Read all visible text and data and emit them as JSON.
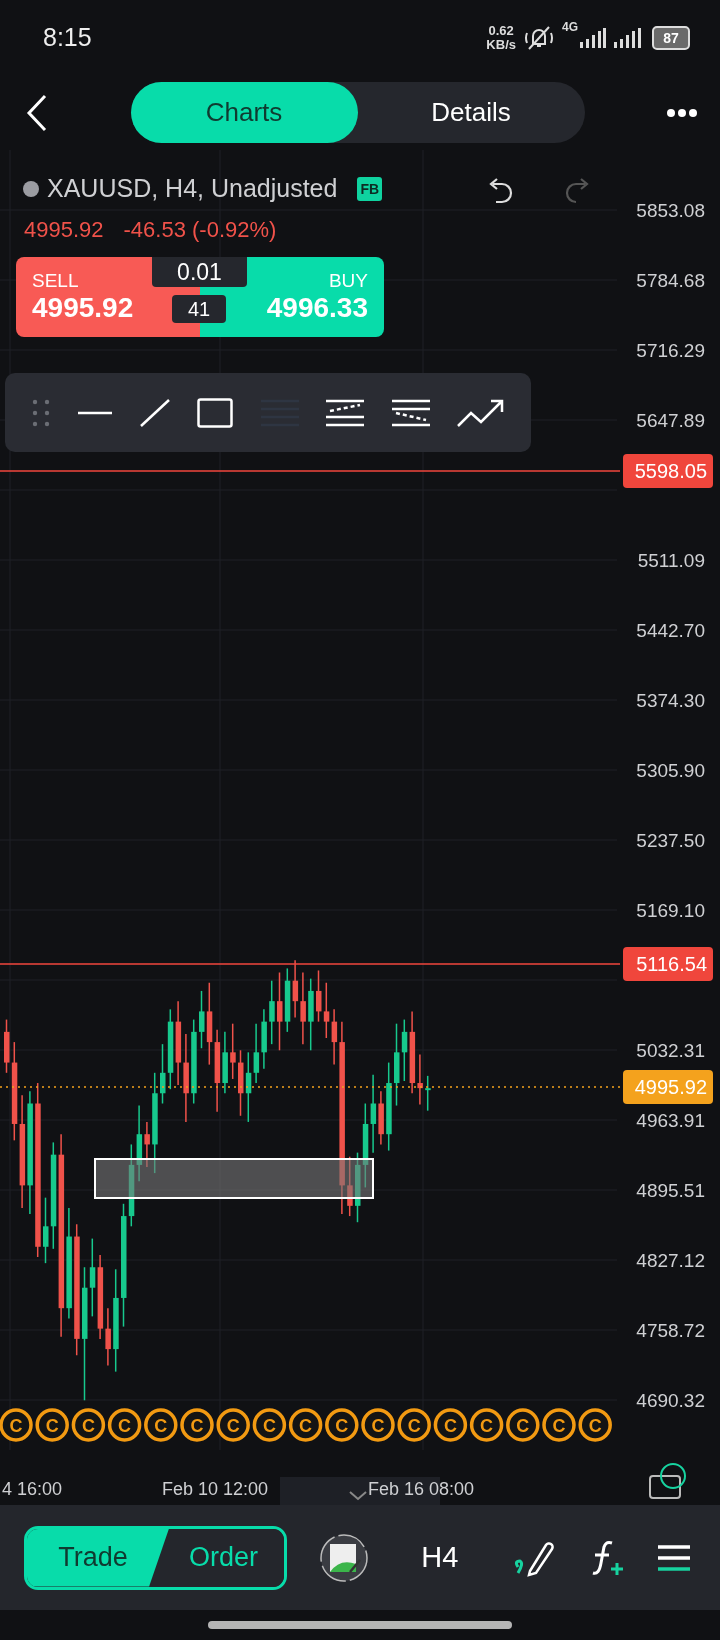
{
  "status_bar": {
    "time": "8:15",
    "net_speed": "0.62",
    "net_speed_unit": "KB/s",
    "network_type": "4G",
    "battery": "87"
  },
  "header": {
    "tabs": [
      {
        "label": "Charts",
        "selected": true
      },
      {
        "label": "Details",
        "selected": false
      }
    ]
  },
  "symbol": {
    "title": "XAUUSD, H4, Unadjusted",
    "badge": "FB",
    "price": "4995.92",
    "change": "-46.53 (-0.92%)"
  },
  "trade_panel": {
    "sell_label": "SELL",
    "sell_price": "4995.92",
    "lot": "0.01",
    "spread": "41",
    "buy_label": "BUY",
    "buy_price": "4996.33"
  },
  "drawing_tools": [
    {
      "kind": "grip",
      "disabled": false
    },
    {
      "kind": "horizontal",
      "disabled": false
    },
    {
      "kind": "trend",
      "disabled": false
    },
    {
      "kind": "rectangle",
      "disabled": false
    },
    {
      "kind": "lines",
      "disabled": true
    },
    {
      "kind": "channel-up",
      "disabled": false
    },
    {
      "kind": "channel-down",
      "disabled": false
    },
    {
      "kind": "path",
      "disabled": false
    }
  ],
  "chart": {
    "y_ticks": [
      "5853.08",
      "5784.68",
      "5716.29",
      "5647.89",
      "5511.09",
      "5442.70",
      "5374.30",
      "5305.90",
      "5237.50",
      "5169.10",
      "5032.31",
      "4963.91",
      "4895.51",
      "4827.12",
      "4758.72",
      "4690.32"
    ],
    "price_tags": [
      {
        "label": "5598.05",
        "kind": "line"
      },
      {
        "label": "5116.54",
        "kind": "line"
      },
      {
        "label": "4995.92",
        "kind": "current"
      }
    ],
    "event_markers": [
      "C",
      "C",
      "C",
      "C",
      "C",
      "C",
      "C",
      "C",
      "C",
      "C",
      "C",
      "C",
      "C",
      "C",
      "C",
      "C",
      "C"
    ],
    "x_labels": [
      "4 16:00",
      "Feb 10 12:00",
      "Feb 16 08:00"
    ]
  },
  "bottom_bar": {
    "mode_tabs": [
      {
        "label": "Trade",
        "selected": true
      },
      {
        "label": "Order",
        "selected": false
      }
    ],
    "timeframe": "H4"
  }
}
